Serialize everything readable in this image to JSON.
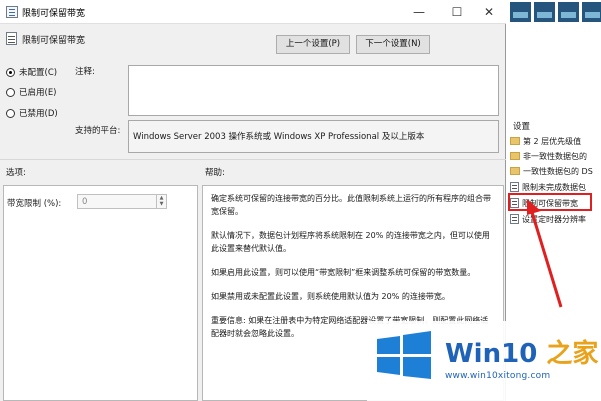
{
  "window": {
    "title": "限制可保留带宽",
    "minimize": "—",
    "maximize": "☐",
    "close": "✕"
  },
  "header": {
    "policy_name": "限制可保留带宽"
  },
  "nav": {
    "prev_label": "上一个设置(P)",
    "next_label": "下一个设置(N)"
  },
  "state": {
    "options": [
      {
        "label": "未配置(C)",
        "selected": true
      },
      {
        "label": "已启用(E)",
        "selected": false
      },
      {
        "label": "已禁用(D)",
        "selected": false
      }
    ]
  },
  "comment": {
    "label": "注释:",
    "value": ""
  },
  "supported": {
    "label": "支持的平台:",
    "value": "Windows Server 2003 操作系统或 Windows XP Professional 及以上版本"
  },
  "options_panel": {
    "heading": "选项:",
    "bandwidth_label": "带宽限制 (%):",
    "bandwidth_value": "0"
  },
  "help_panel": {
    "heading": "帮助:",
    "paragraphs": [
      "确定系统可保留的连接带宽的百分比。此值限制系统上运行的所有程序的组合带宽保留。",
      "默认情况下，数据包计划程序将系统限制在 20% 的连接带宽之内，但可以使用此设置来替代默认值。",
      "如果启用此设置，则可以使用“带宽限制”框来调整系统可保留的带宽数量。",
      "如果禁用或未配置此设置，则系统使用默认值为 20% 的连接带宽。",
      "重要信息: 如果在注册表中为特定网络适配器设置了带宽限制，则配置此网络适配器时就会忽略此设置。"
    ]
  },
  "background": {
    "section_label": "设置",
    "items": [
      {
        "label": "第 2 层优先级值",
        "kind": "folder"
      },
      {
        "label": "非一致性数据包的",
        "kind": "folder"
      },
      {
        "label": "一致性数据包的 DS",
        "kind": "folder"
      },
      {
        "label": "限制未完成数据包",
        "kind": "policy"
      },
      {
        "label": "限制可保留带宽",
        "kind": "policy"
      },
      {
        "label": "设置定时器分辨率",
        "kind": "policy"
      }
    ],
    "highlight_color": "#e02020"
  },
  "watermark": {
    "brand_prefix": "Win10 ",
    "brand_suffix": "之家",
    "url": "www.win10xitong.com"
  }
}
